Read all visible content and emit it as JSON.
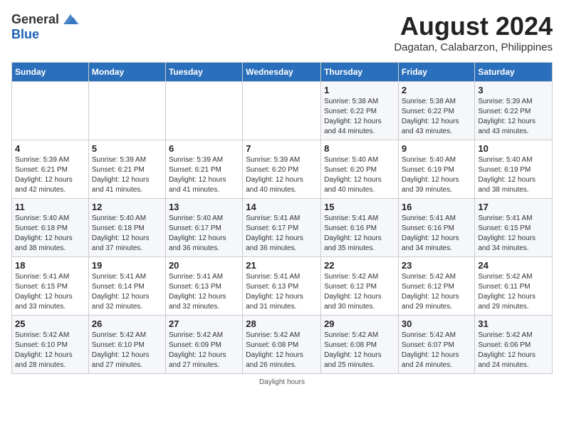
{
  "header": {
    "logo_general": "General",
    "logo_blue": "Blue",
    "month_title": "August 2024",
    "location": "Dagatan, Calabarzon, Philippines"
  },
  "weekdays": [
    "Sunday",
    "Monday",
    "Tuesday",
    "Wednesday",
    "Thursday",
    "Friday",
    "Saturday"
  ],
  "weeks": [
    [
      {
        "day": "",
        "info": ""
      },
      {
        "day": "",
        "info": ""
      },
      {
        "day": "",
        "info": ""
      },
      {
        "day": "",
        "info": ""
      },
      {
        "day": "1",
        "info": "Sunrise: 5:38 AM\nSunset: 6:22 PM\nDaylight: 12 hours\nand 44 minutes."
      },
      {
        "day": "2",
        "info": "Sunrise: 5:38 AM\nSunset: 6:22 PM\nDaylight: 12 hours\nand 43 minutes."
      },
      {
        "day": "3",
        "info": "Sunrise: 5:39 AM\nSunset: 6:22 PM\nDaylight: 12 hours\nand 43 minutes."
      }
    ],
    [
      {
        "day": "4",
        "info": "Sunrise: 5:39 AM\nSunset: 6:21 PM\nDaylight: 12 hours\nand 42 minutes."
      },
      {
        "day": "5",
        "info": "Sunrise: 5:39 AM\nSunset: 6:21 PM\nDaylight: 12 hours\nand 41 minutes."
      },
      {
        "day": "6",
        "info": "Sunrise: 5:39 AM\nSunset: 6:21 PM\nDaylight: 12 hours\nand 41 minutes."
      },
      {
        "day": "7",
        "info": "Sunrise: 5:39 AM\nSunset: 6:20 PM\nDaylight: 12 hours\nand 40 minutes."
      },
      {
        "day": "8",
        "info": "Sunrise: 5:40 AM\nSunset: 6:20 PM\nDaylight: 12 hours\nand 40 minutes."
      },
      {
        "day": "9",
        "info": "Sunrise: 5:40 AM\nSunset: 6:19 PM\nDaylight: 12 hours\nand 39 minutes."
      },
      {
        "day": "10",
        "info": "Sunrise: 5:40 AM\nSunset: 6:19 PM\nDaylight: 12 hours\nand 38 minutes."
      }
    ],
    [
      {
        "day": "11",
        "info": "Sunrise: 5:40 AM\nSunset: 6:18 PM\nDaylight: 12 hours\nand 38 minutes."
      },
      {
        "day": "12",
        "info": "Sunrise: 5:40 AM\nSunset: 6:18 PM\nDaylight: 12 hours\nand 37 minutes."
      },
      {
        "day": "13",
        "info": "Sunrise: 5:40 AM\nSunset: 6:17 PM\nDaylight: 12 hours\nand 36 minutes."
      },
      {
        "day": "14",
        "info": "Sunrise: 5:41 AM\nSunset: 6:17 PM\nDaylight: 12 hours\nand 36 minutes."
      },
      {
        "day": "15",
        "info": "Sunrise: 5:41 AM\nSunset: 6:16 PM\nDaylight: 12 hours\nand 35 minutes."
      },
      {
        "day": "16",
        "info": "Sunrise: 5:41 AM\nSunset: 6:16 PM\nDaylight: 12 hours\nand 34 minutes."
      },
      {
        "day": "17",
        "info": "Sunrise: 5:41 AM\nSunset: 6:15 PM\nDaylight: 12 hours\nand 34 minutes."
      }
    ],
    [
      {
        "day": "18",
        "info": "Sunrise: 5:41 AM\nSunset: 6:15 PM\nDaylight: 12 hours\nand 33 minutes."
      },
      {
        "day": "19",
        "info": "Sunrise: 5:41 AM\nSunset: 6:14 PM\nDaylight: 12 hours\nand 32 minutes."
      },
      {
        "day": "20",
        "info": "Sunrise: 5:41 AM\nSunset: 6:13 PM\nDaylight: 12 hours\nand 32 minutes."
      },
      {
        "day": "21",
        "info": "Sunrise: 5:41 AM\nSunset: 6:13 PM\nDaylight: 12 hours\nand 31 minutes."
      },
      {
        "day": "22",
        "info": "Sunrise: 5:42 AM\nSunset: 6:12 PM\nDaylight: 12 hours\nand 30 minutes."
      },
      {
        "day": "23",
        "info": "Sunrise: 5:42 AM\nSunset: 6:12 PM\nDaylight: 12 hours\nand 29 minutes."
      },
      {
        "day": "24",
        "info": "Sunrise: 5:42 AM\nSunset: 6:11 PM\nDaylight: 12 hours\nand 29 minutes."
      }
    ],
    [
      {
        "day": "25",
        "info": "Sunrise: 5:42 AM\nSunset: 6:10 PM\nDaylight: 12 hours\nand 28 minutes."
      },
      {
        "day": "26",
        "info": "Sunrise: 5:42 AM\nSunset: 6:10 PM\nDaylight: 12 hours\nand 27 minutes."
      },
      {
        "day": "27",
        "info": "Sunrise: 5:42 AM\nSunset: 6:09 PM\nDaylight: 12 hours\nand 27 minutes."
      },
      {
        "day": "28",
        "info": "Sunrise: 5:42 AM\nSunset: 6:08 PM\nDaylight: 12 hours\nand 26 minutes."
      },
      {
        "day": "29",
        "info": "Sunrise: 5:42 AM\nSunset: 6:08 PM\nDaylight: 12 hours\nand 25 minutes."
      },
      {
        "day": "30",
        "info": "Sunrise: 5:42 AM\nSunset: 6:07 PM\nDaylight: 12 hours\nand 24 minutes."
      },
      {
        "day": "31",
        "info": "Sunrise: 5:42 AM\nSunset: 6:06 PM\nDaylight: 12 hours\nand 24 minutes."
      }
    ]
  ],
  "footer": {
    "daylight_label": "Daylight hours"
  }
}
